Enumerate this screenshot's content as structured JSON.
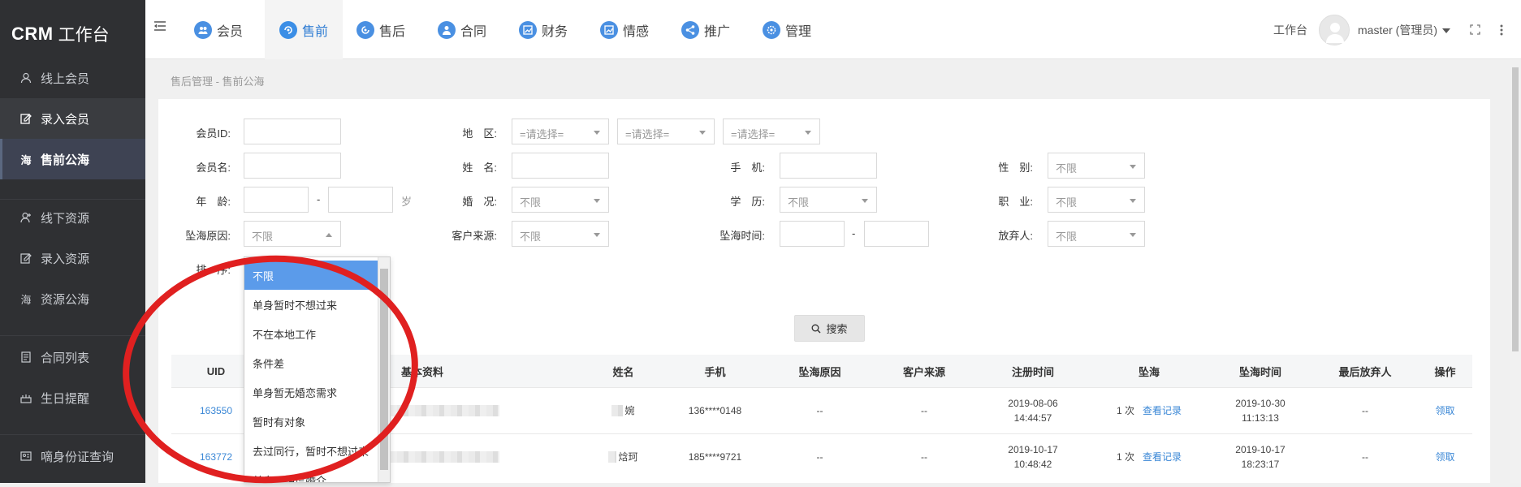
{
  "brand": {
    "bold": "CRM",
    "text": "工作台"
  },
  "sidebar": {
    "items": [
      {
        "label": "线上会员",
        "icon": "user-icon"
      },
      {
        "label": "录入会员",
        "icon": "edit-icon"
      },
      {
        "label": "售前公海",
        "icon": "sea-icon",
        "icon_text": "海"
      },
      {
        "label": "线下资源",
        "icon": "user-add-icon"
      },
      {
        "label": "录入资源",
        "icon": "edit-icon"
      },
      {
        "label": "资源公海",
        "icon": "sea-icon",
        "icon_text": "海"
      },
      {
        "label": "合同列表",
        "icon": "document-icon"
      },
      {
        "label": "生日提醒",
        "icon": "cake-icon"
      },
      {
        "label": "嘀身份证查询",
        "icon": "id-card-icon"
      }
    ]
  },
  "topnav": {
    "items": [
      {
        "label": "会员",
        "icon": "members-icon"
      },
      {
        "label": "售前",
        "icon": "presale-icon"
      },
      {
        "label": "售后",
        "icon": "aftersale-icon"
      },
      {
        "label": "合同",
        "icon": "contract-icon"
      },
      {
        "label": "财务",
        "icon": "finance-icon"
      },
      {
        "label": "情感",
        "icon": "emotion-icon"
      },
      {
        "label": "推广",
        "icon": "share-icon"
      },
      {
        "label": "管理",
        "icon": "settings-icon"
      }
    ],
    "active": "售前",
    "workbench": "工作台",
    "user": "master (管理员)"
  },
  "breadcrumb": "售后管理 - 售前公海",
  "filters": {
    "member_id": "会员ID:",
    "region": "地　区:",
    "region_placeholder": "=请选择=",
    "member_name": "会员名:",
    "surname": "姓　名:",
    "phone": "手　机:",
    "gender": "性　别:",
    "age": "年　龄:",
    "age_unit": "岁",
    "marital": "婚　况:",
    "education": "学　历:",
    "occupation": "职　业:",
    "sea_reason": "坠海原因:",
    "customer_source": "客户来源:",
    "sea_time": "坠海时间:",
    "abandoner": "放弃人:",
    "sort": "排　序:",
    "unlimited": "不限",
    "dash": "-",
    "search_button": "搜索"
  },
  "dropdown": {
    "options": [
      "不限",
      "单身暂时不想过来",
      "不在本地工作",
      "条件差",
      "单身暂无婚恋需求",
      "暂时有对象",
      "去过同行，暂时不想过来",
      "单身不相信婚介"
    ],
    "selected": "不限"
  },
  "table": {
    "headers": [
      "UID",
      "基本资料",
      "姓名",
      "手机",
      "坠海原因",
      "客户来源",
      "注册时间",
      "坠海",
      "坠海时间",
      "最后放弃人",
      "操作"
    ],
    "rows": [
      {
        "uid": "163550",
        "name": "婉",
        "phone": "136****0148",
        "reason": "--",
        "source": "--",
        "reg_date": "2019-08-06",
        "reg_time": "14:44:57",
        "sea_count": "1 次",
        "view": "查看记录",
        "sea_date": "2019-10-30",
        "sea_time": "11:13:13",
        "abandoner": "--",
        "action": "领取"
      },
      {
        "uid": "163772",
        "name": "焓珂",
        "phone": "185****9721",
        "reason": "--",
        "source": "--",
        "reg_date": "2019-10-17",
        "reg_time": "10:48:42",
        "sea_count": "1 次",
        "view": "查看记录",
        "sea_date": "2019-10-17",
        "sea_time": "18:23:17",
        "abandoner": "--",
        "action": "领取"
      }
    ]
  },
  "colors": {
    "sidebar_bg": "#2f3033",
    "accent": "#3a87d6",
    "selected_option": "#5b9bea",
    "annotation": "#e02020"
  }
}
